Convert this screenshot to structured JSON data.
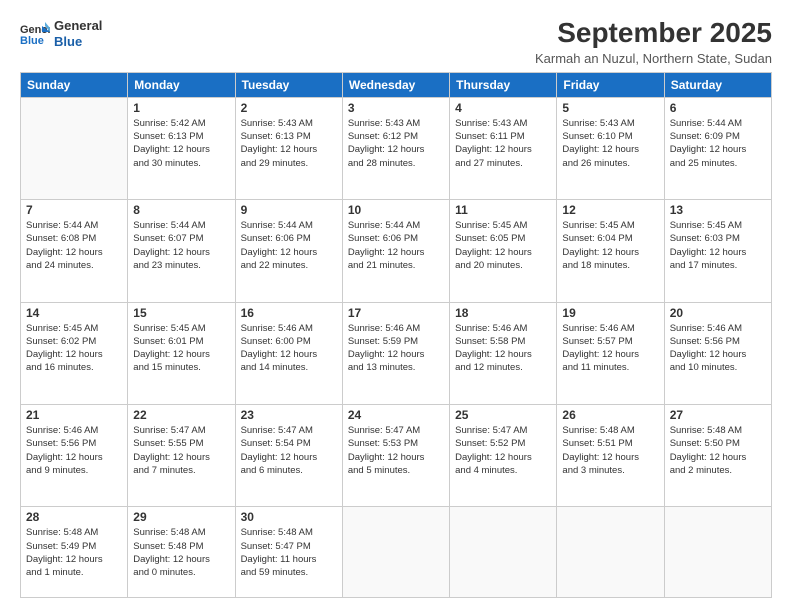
{
  "logo": {
    "line1": "General",
    "line2": "Blue"
  },
  "title": "September 2025",
  "subtitle": "Karmah an Nuzul, Northern State, Sudan",
  "headers": [
    "Sunday",
    "Monday",
    "Tuesday",
    "Wednesday",
    "Thursday",
    "Friday",
    "Saturday"
  ],
  "weeks": [
    [
      {
        "day": "",
        "lines": []
      },
      {
        "day": "1",
        "lines": [
          "Sunrise: 5:42 AM",
          "Sunset: 6:13 PM",
          "Daylight: 12 hours",
          "and 30 minutes."
        ]
      },
      {
        "day": "2",
        "lines": [
          "Sunrise: 5:43 AM",
          "Sunset: 6:13 PM",
          "Daylight: 12 hours",
          "and 29 minutes."
        ]
      },
      {
        "day": "3",
        "lines": [
          "Sunrise: 5:43 AM",
          "Sunset: 6:12 PM",
          "Daylight: 12 hours",
          "and 28 minutes."
        ]
      },
      {
        "day": "4",
        "lines": [
          "Sunrise: 5:43 AM",
          "Sunset: 6:11 PM",
          "Daylight: 12 hours",
          "and 27 minutes."
        ]
      },
      {
        "day": "5",
        "lines": [
          "Sunrise: 5:43 AM",
          "Sunset: 6:10 PM",
          "Daylight: 12 hours",
          "and 26 minutes."
        ]
      },
      {
        "day": "6",
        "lines": [
          "Sunrise: 5:44 AM",
          "Sunset: 6:09 PM",
          "Daylight: 12 hours",
          "and 25 minutes."
        ]
      }
    ],
    [
      {
        "day": "7",
        "lines": [
          "Sunrise: 5:44 AM",
          "Sunset: 6:08 PM",
          "Daylight: 12 hours",
          "and 24 minutes."
        ]
      },
      {
        "day": "8",
        "lines": [
          "Sunrise: 5:44 AM",
          "Sunset: 6:07 PM",
          "Daylight: 12 hours",
          "and 23 minutes."
        ]
      },
      {
        "day": "9",
        "lines": [
          "Sunrise: 5:44 AM",
          "Sunset: 6:06 PM",
          "Daylight: 12 hours",
          "and 22 minutes."
        ]
      },
      {
        "day": "10",
        "lines": [
          "Sunrise: 5:44 AM",
          "Sunset: 6:06 PM",
          "Daylight: 12 hours",
          "and 21 minutes."
        ]
      },
      {
        "day": "11",
        "lines": [
          "Sunrise: 5:45 AM",
          "Sunset: 6:05 PM",
          "Daylight: 12 hours",
          "and 20 minutes."
        ]
      },
      {
        "day": "12",
        "lines": [
          "Sunrise: 5:45 AM",
          "Sunset: 6:04 PM",
          "Daylight: 12 hours",
          "and 18 minutes."
        ]
      },
      {
        "day": "13",
        "lines": [
          "Sunrise: 5:45 AM",
          "Sunset: 6:03 PM",
          "Daylight: 12 hours",
          "and 17 minutes."
        ]
      }
    ],
    [
      {
        "day": "14",
        "lines": [
          "Sunrise: 5:45 AM",
          "Sunset: 6:02 PM",
          "Daylight: 12 hours",
          "and 16 minutes."
        ]
      },
      {
        "day": "15",
        "lines": [
          "Sunrise: 5:45 AM",
          "Sunset: 6:01 PM",
          "Daylight: 12 hours",
          "and 15 minutes."
        ]
      },
      {
        "day": "16",
        "lines": [
          "Sunrise: 5:46 AM",
          "Sunset: 6:00 PM",
          "Daylight: 12 hours",
          "and 14 minutes."
        ]
      },
      {
        "day": "17",
        "lines": [
          "Sunrise: 5:46 AM",
          "Sunset: 5:59 PM",
          "Daylight: 12 hours",
          "and 13 minutes."
        ]
      },
      {
        "day": "18",
        "lines": [
          "Sunrise: 5:46 AM",
          "Sunset: 5:58 PM",
          "Daylight: 12 hours",
          "and 12 minutes."
        ]
      },
      {
        "day": "19",
        "lines": [
          "Sunrise: 5:46 AM",
          "Sunset: 5:57 PM",
          "Daylight: 12 hours",
          "and 11 minutes."
        ]
      },
      {
        "day": "20",
        "lines": [
          "Sunrise: 5:46 AM",
          "Sunset: 5:56 PM",
          "Daylight: 12 hours",
          "and 10 minutes."
        ]
      }
    ],
    [
      {
        "day": "21",
        "lines": [
          "Sunrise: 5:46 AM",
          "Sunset: 5:56 PM",
          "Daylight: 12 hours",
          "and 9 minutes."
        ]
      },
      {
        "day": "22",
        "lines": [
          "Sunrise: 5:47 AM",
          "Sunset: 5:55 PM",
          "Daylight: 12 hours",
          "and 7 minutes."
        ]
      },
      {
        "day": "23",
        "lines": [
          "Sunrise: 5:47 AM",
          "Sunset: 5:54 PM",
          "Daylight: 12 hours",
          "and 6 minutes."
        ]
      },
      {
        "day": "24",
        "lines": [
          "Sunrise: 5:47 AM",
          "Sunset: 5:53 PM",
          "Daylight: 12 hours",
          "and 5 minutes."
        ]
      },
      {
        "day": "25",
        "lines": [
          "Sunrise: 5:47 AM",
          "Sunset: 5:52 PM",
          "Daylight: 12 hours",
          "and 4 minutes."
        ]
      },
      {
        "day": "26",
        "lines": [
          "Sunrise: 5:48 AM",
          "Sunset: 5:51 PM",
          "Daylight: 12 hours",
          "and 3 minutes."
        ]
      },
      {
        "day": "27",
        "lines": [
          "Sunrise: 5:48 AM",
          "Sunset: 5:50 PM",
          "Daylight: 12 hours",
          "and 2 minutes."
        ]
      }
    ],
    [
      {
        "day": "28",
        "lines": [
          "Sunrise: 5:48 AM",
          "Sunset: 5:49 PM",
          "Daylight: 12 hours",
          "and 1 minute."
        ]
      },
      {
        "day": "29",
        "lines": [
          "Sunrise: 5:48 AM",
          "Sunset: 5:48 PM",
          "Daylight: 12 hours",
          "and 0 minutes."
        ]
      },
      {
        "day": "30",
        "lines": [
          "Sunrise: 5:48 AM",
          "Sunset: 5:47 PM",
          "Daylight: 11 hours",
          "and 59 minutes."
        ]
      },
      {
        "day": "",
        "lines": []
      },
      {
        "day": "",
        "lines": []
      },
      {
        "day": "",
        "lines": []
      },
      {
        "day": "",
        "lines": []
      }
    ]
  ]
}
